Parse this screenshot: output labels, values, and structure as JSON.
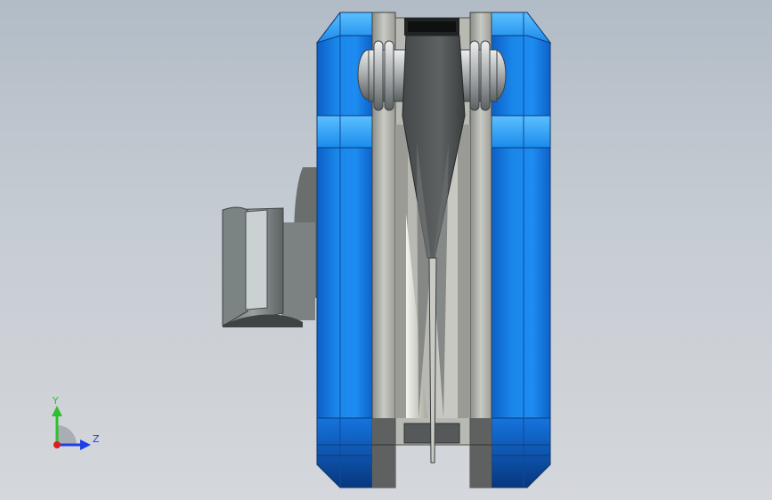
{
  "viewport": {
    "background_top": "#b2bcc6",
    "background_bottom": "#d4d7db"
  },
  "model": {
    "body_color": "#1a7fe6",
    "body_highlight": "#4fb2ff",
    "body_dark": "#0a4fa8",
    "metal_light": "#d7d8d3",
    "metal_mid": "#a9aaa4",
    "metal_dark": "#55595a"
  },
  "triad": {
    "y_label": "Y",
    "z_label": "Z",
    "y_color": "#2fbf2f",
    "z_color": "#1f3fe6",
    "x_color": "#e01c1c"
  }
}
